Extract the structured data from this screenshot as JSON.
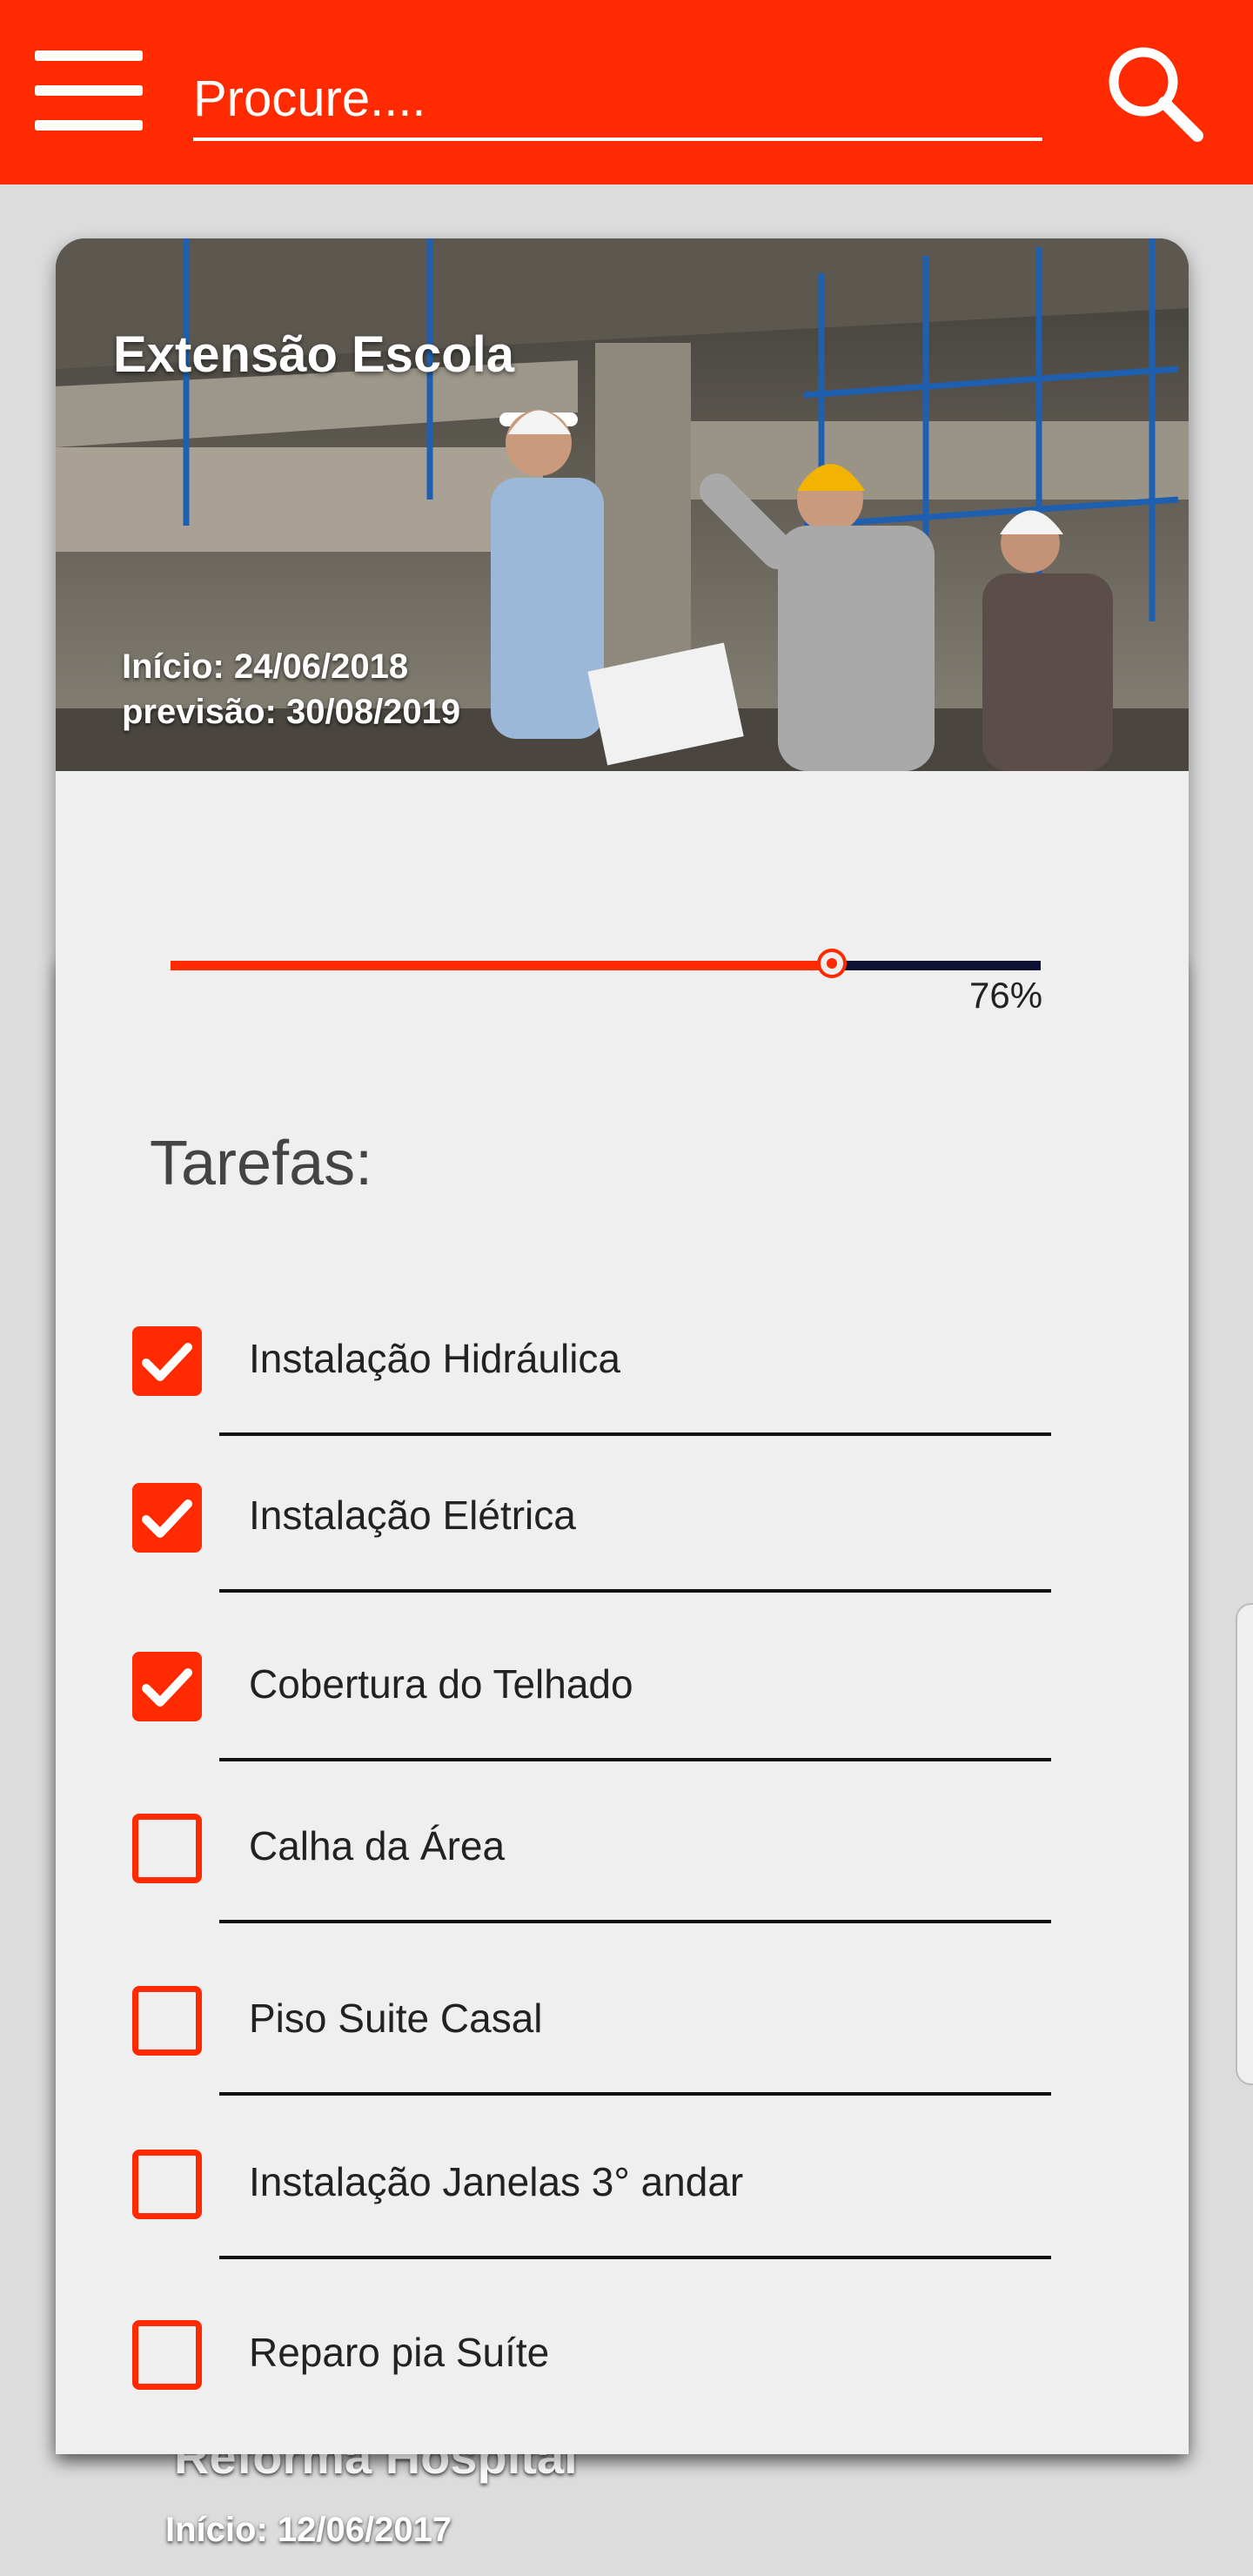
{
  "search": {
    "placeholder": "Procure...."
  },
  "project": {
    "title": "Extensão Escola",
    "start": "Início: 24/06/2018",
    "forecast": "previsão: 30/08/2019",
    "progress": 76,
    "progress_label": "76%"
  },
  "tasks_heading": "Tarefas:",
  "tasks": [
    {
      "label": "Instalação Hidráulica",
      "done": true
    },
    {
      "label": "Instalação Elétrica",
      "done": true
    },
    {
      "label": "Cobertura do Telhado",
      "done": true
    },
    {
      "label": "Calha da Área",
      "done": false
    },
    {
      "label": "Piso Suite Casal",
      "done": false
    },
    {
      "label": "Instalação Janelas 3° andar",
      "done": false
    },
    {
      "label": "Reparo pia Suíte",
      "done": false
    }
  ],
  "background_card": {
    "title": "Reforma Hospital",
    "start": "Início: 12/06/2017"
  },
  "colors": {
    "accent": "#ff2a00",
    "track": "#0d1030",
    "card": "#efefef",
    "background": "#dcdcdc"
  },
  "icons": {
    "menu": "menu-icon",
    "search": "search-icon",
    "check": "check-icon"
  }
}
